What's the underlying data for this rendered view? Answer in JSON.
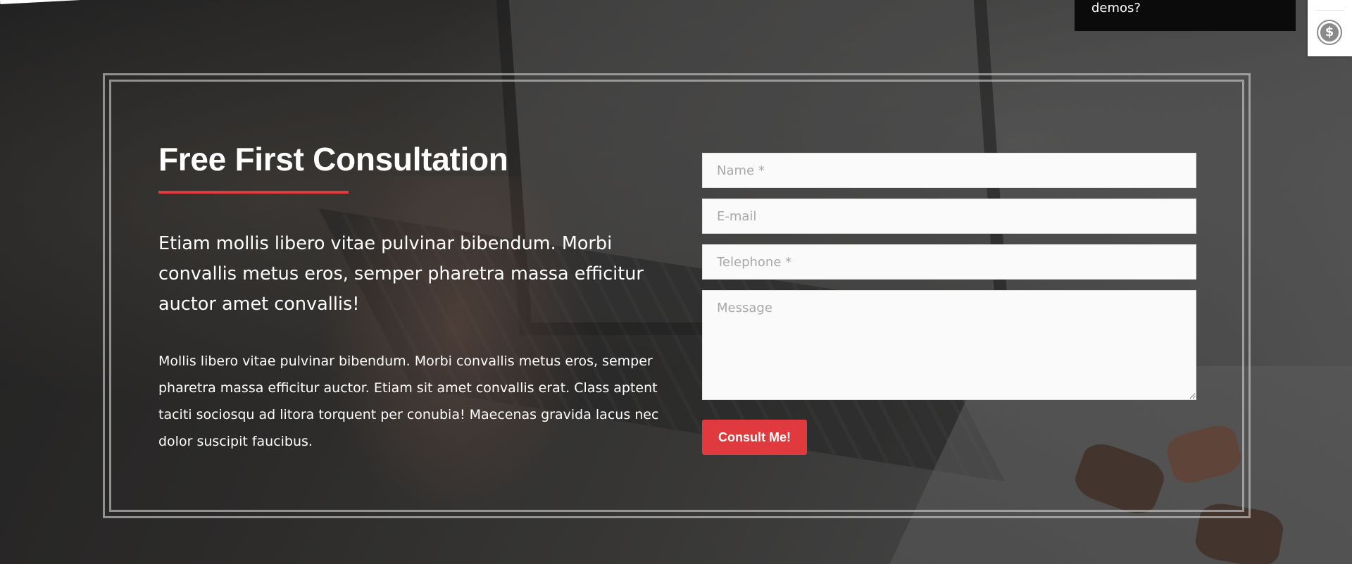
{
  "consultation": {
    "title": "Free First Consultation",
    "lead": "Etiam mollis libero vitae pulvinar bibendum. Morbi convallis metus eros, semper pharetra massa efficitur auctor amet convallis!",
    "body": "Mollis libero vitae pulvinar bibendum. Morbi convallis metus eros, semper pharetra massa efficitur auctor. Etiam sit amet convallis erat. Class aptent taciti sociosqu ad litora torquent per conubia! Maecenas gravida lacus nec dolor suscipit faucibus.",
    "accent_color": "#e0393e"
  },
  "form": {
    "name_placeholder": "Name *",
    "email_placeholder": "E-mail",
    "telephone_placeholder": "Telephone *",
    "message_placeholder": "Message",
    "name_value": "",
    "email_value": "",
    "telephone_value": "",
    "message_value": "",
    "submit_label": "Consult Me!"
  },
  "tooltip": {
    "text": "demos?"
  },
  "side_widget": {
    "icon": "dollar-icon",
    "symbol": "$"
  }
}
